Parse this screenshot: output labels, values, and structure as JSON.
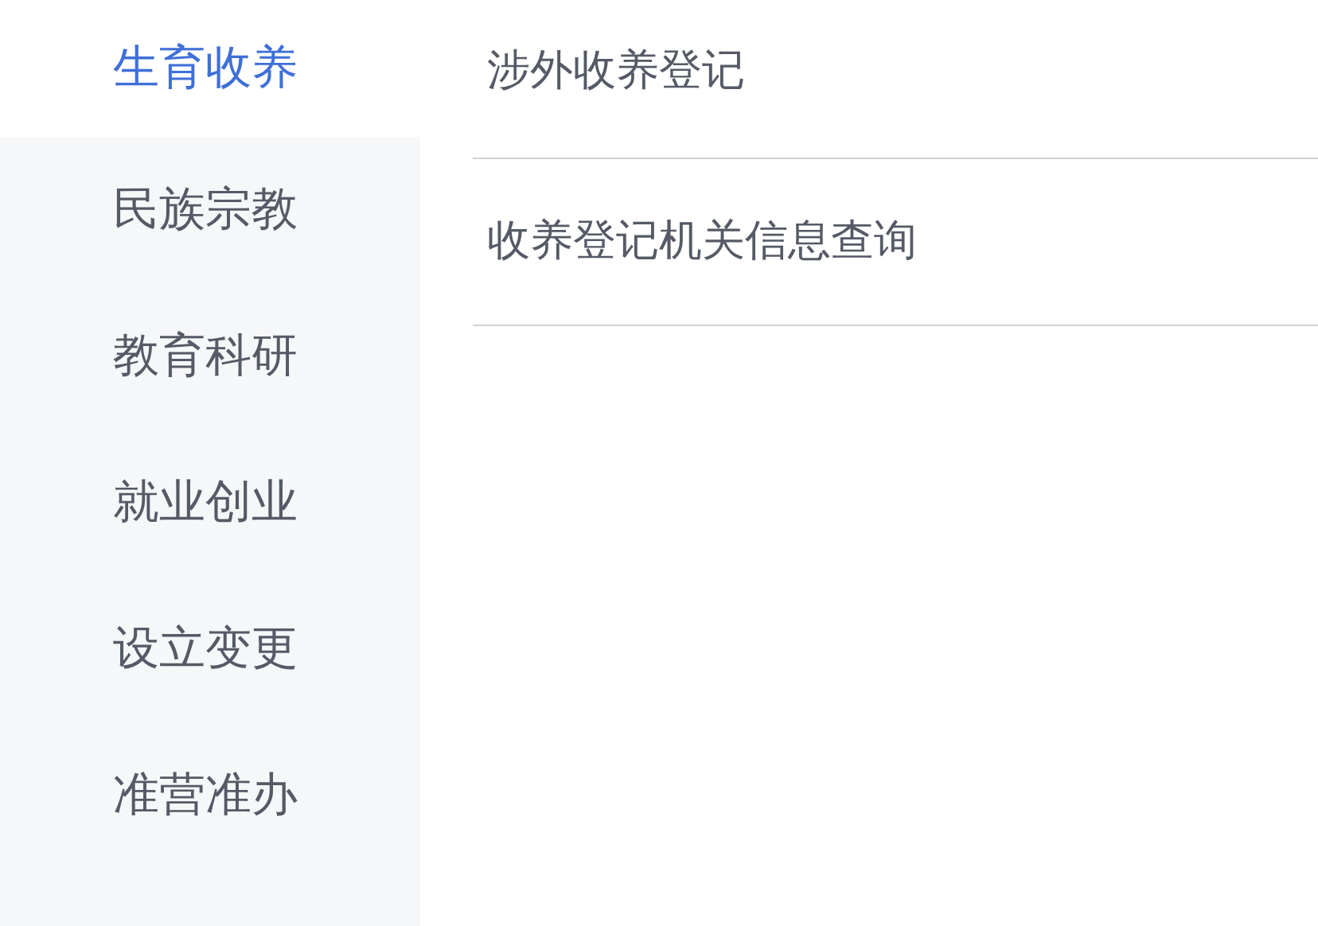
{
  "sidebar": {
    "items": [
      {
        "label": "生育收养",
        "selected": true
      },
      {
        "label": "民族宗教",
        "selected": false
      },
      {
        "label": "教育科研",
        "selected": false
      },
      {
        "label": "就业创业",
        "selected": false
      },
      {
        "label": "设立变更",
        "selected": false
      },
      {
        "label": "准营准办",
        "selected": false
      }
    ]
  },
  "list": {
    "items": [
      {
        "label": "涉外收养登记"
      },
      {
        "label": "收养登记机关信息查询"
      }
    ]
  }
}
